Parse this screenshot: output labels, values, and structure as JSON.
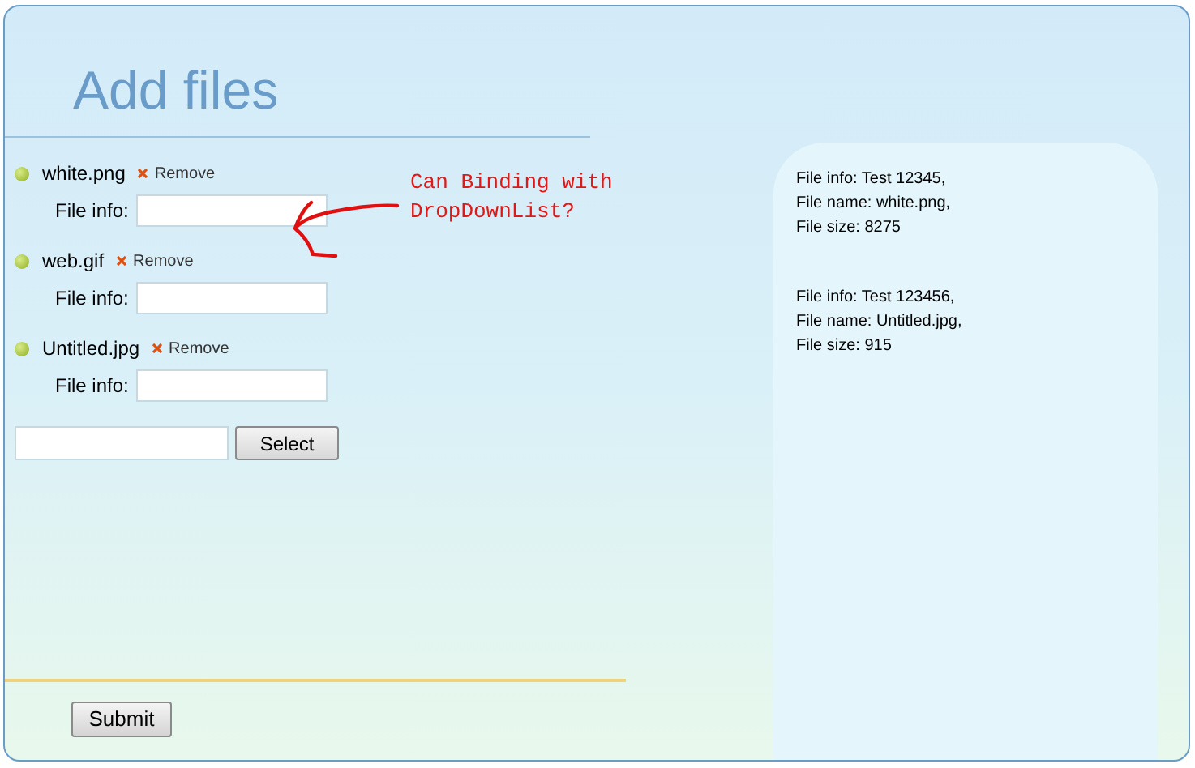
{
  "title": "Add files",
  "files": [
    {
      "name": "white.png",
      "remove": "Remove",
      "info_label": "File info:"
    },
    {
      "name": "web.gif",
      "remove": "Remove",
      "info_label": "File info:"
    },
    {
      "name": "Untitled.jpg",
      "remove": "Remove",
      "info_label": "File info:"
    }
  ],
  "select_button": "Select",
  "annotation": [
    "Can Binding with",
    "DropDownList?"
  ],
  "summary": [
    [
      "File info: Test 12345,",
      "File name: white.png,",
      "File size: 8275"
    ],
    [
      "File info: Test 123456,",
      "File name: Untitled.jpg,",
      "File size: 915"
    ]
  ],
  "submit_button": "Submit"
}
